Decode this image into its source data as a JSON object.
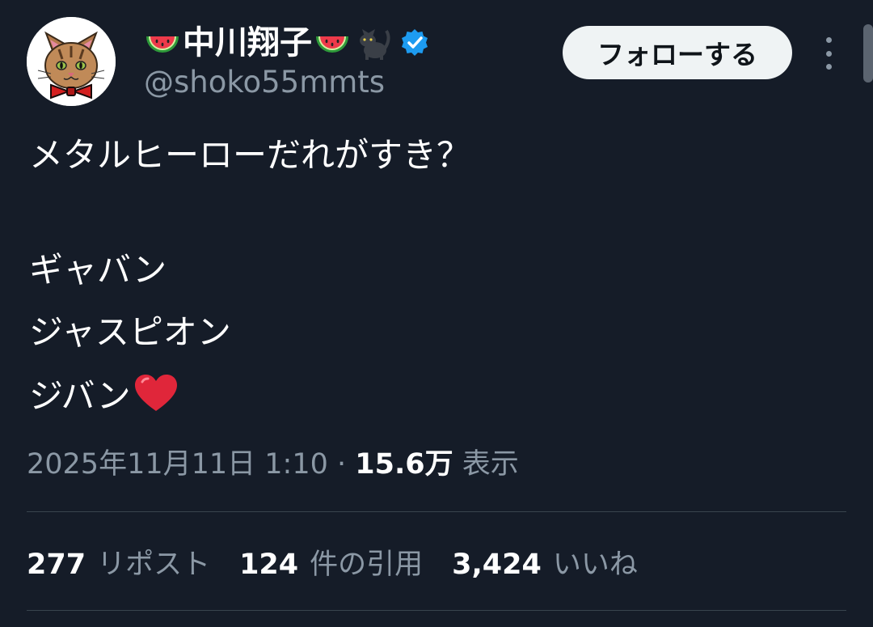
{
  "profile": {
    "display_name": "中川翔子",
    "handle": "@shoko55mmts",
    "name_emojis": [
      "watermelon-icon",
      "watermelon-icon",
      "black-cat-icon"
    ],
    "verified_color": "#1d9bf0"
  },
  "follow_button": {
    "label": "フォローする"
  },
  "tweet": {
    "lines": [
      "メタルヒーローだれがすき？",
      "",
      "ギャバン",
      "ジャスピオン",
      "ジバン"
    ],
    "trailing_emoji": "red-heart-icon"
  },
  "meta": {
    "date": "2025年11月11日 1:10",
    "separator": " · ",
    "views_count": "15.6万",
    "views_label": " 表示"
  },
  "stats": [
    {
      "count": "277",
      "label": "リポスト"
    },
    {
      "count": "124",
      "label": "件の引用"
    },
    {
      "count": "3,424",
      "label": "いいね"
    }
  ],
  "colors": {
    "background": "#151c28",
    "secondary_text": "#8b98a5",
    "divider": "#38444d",
    "button_bg": "#eff3f4"
  }
}
